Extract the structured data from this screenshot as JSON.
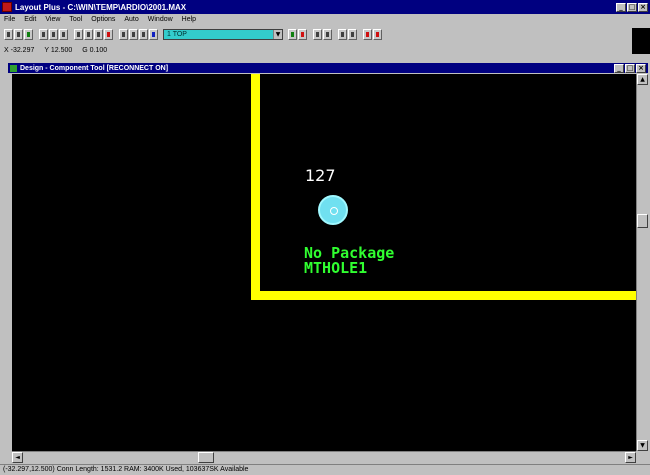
{
  "window": {
    "title": "Layout Plus - C:\\WIN\\TEMP\\ARDIO\\2001.MAX",
    "min": "_",
    "max": "□",
    "close": "×"
  },
  "menu": [
    "File",
    "Edit",
    "View",
    "Tool",
    "Options",
    "Auto",
    "Window",
    "Help"
  ],
  "toolbar": {
    "layer_value": "1 TOP",
    "layer_arrow": "▼"
  },
  "coords": {
    "x": "X -32.297",
    "y": "Y 12.500",
    "g": "G 0.100"
  },
  "child_window": {
    "title": "Design - Component Tool [RECONNECT ON]"
  },
  "canvas": {
    "refdes": "127",
    "package_line1": "No Package",
    "package_line2": "MTHOLE1",
    "colors": {
      "board_outline": "#ffff00",
      "pad": "#70e0f0",
      "text": "#30ff30"
    }
  },
  "scroll": {
    "left": "◄",
    "right": "►",
    "up": "▲",
    "down": "▼"
  },
  "status": {
    "text": "(-32.297,12.500) Conn Length: 1531.2    RAM: 3400K Used, 103637SK Available"
  }
}
